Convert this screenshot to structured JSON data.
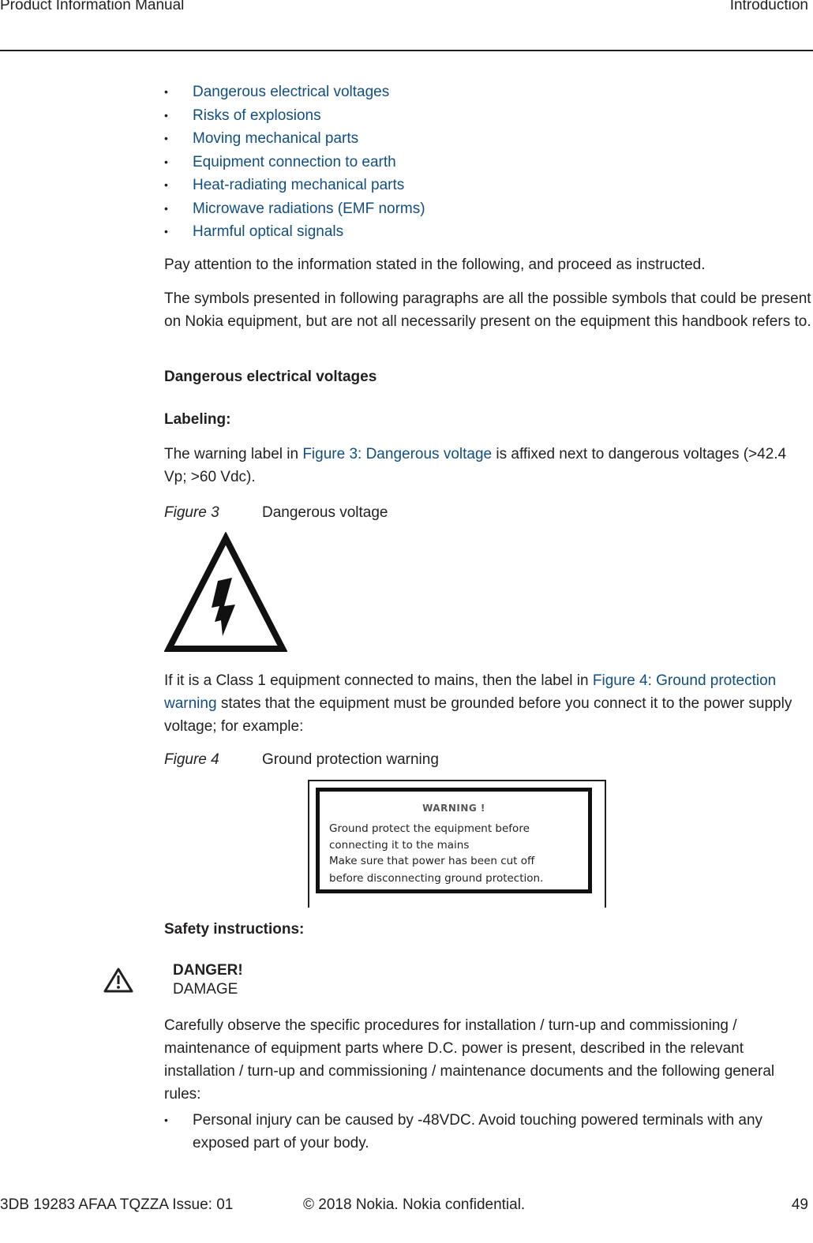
{
  "header": {
    "left": "Product Information Manual",
    "right": "Introduction"
  },
  "hazard_list": [
    "Dangerous electrical voltages",
    "Risks of explosions",
    "Moving mechanical parts",
    "Equipment connection to earth",
    "Heat-radiating mechanical parts",
    "Microwave radiations (EMF norms)",
    "Harmful optical signals"
  ],
  "bullet_glyph": "•",
  "paragraphs": {
    "attention": "Pay attention to the information stated in the following, and proceed as instructed.",
    "symbols": "The symbols presented in following paragraphs are all the possible symbols that could be present on Nokia equipment, but are not all necessarily present on the equipment this handbook refers to."
  },
  "section": {
    "title": "Dangerous electrical voltages",
    "labeling_heading": "Labeling:",
    "labeling_text_pre": "The warning label in ",
    "labeling_link": "Figure 3: Dangerous voltage",
    "labeling_text_post": " is affixed next to dangerous voltages (>42.4 Vp; >60 Vdc).",
    "class1_text_pre": "If it is a Class 1 equipment connected to mains, then the label in ",
    "class1_link": "Figure 4: Ground protection warning",
    "class1_text_post": " states that the equipment must be grounded before you connect it to the power supply voltage; for example:"
  },
  "figures": {
    "fig3": {
      "number": "Figure 3",
      "caption": "Dangerous voltage",
      "icon": "high-voltage-warning-icon"
    },
    "fig4": {
      "number": "Figure 4",
      "caption": "Ground protection warning",
      "label_title": "WARNING !",
      "label_lines": [
        "Ground protect the equipment before",
        "connecting it to the mains",
        "Make sure that power has been cut off",
        "before disconnecting ground protection."
      ]
    }
  },
  "safety": {
    "heading": "Safety instructions:",
    "danger_icon": "warning-triangle-icon",
    "danger_title": "DANGER!",
    "danger_subtitle": "DAMAGE",
    "description": "Carefully observe the specific procedures for installation / turn-up and commissioning / maintenance of equipment parts where D.C. power is present, described in the relevant installation / turn-up and commissioning / maintenance documents and the following general rules:",
    "rules": [
      "Personal injury can be caused by -48VDC. Avoid touching powered terminals with any exposed part of your body."
    ]
  },
  "footer": {
    "doc_id": "3DB 19283 AFAA TQZZA Issue: 01",
    "copyright": "© 2018 Nokia. Nokia confidential.",
    "page_number": "49"
  },
  "colors": {
    "text": "#231f20",
    "link": "#124e82"
  }
}
